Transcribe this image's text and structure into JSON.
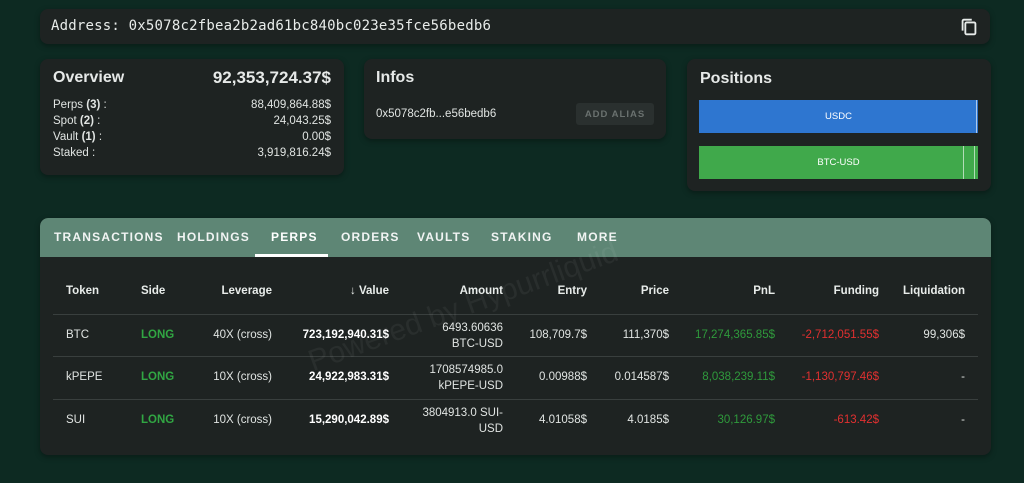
{
  "address_bar": {
    "label": "Address:",
    "address": "0x5078c2fbea2b2ad61bc840bc023e35fce56bedb6",
    "copy_icon": "copy-icon"
  },
  "overview": {
    "title": "Overview",
    "total": "92,353,724.37$",
    "rows": [
      {
        "label": "Perps",
        "count": "(3)",
        "suffix": " :",
        "value": "88,409,864.88$"
      },
      {
        "label": "Spot",
        "count": "(2)",
        "suffix": " :",
        "value": "24,043.25$"
      },
      {
        "label": "Vault",
        "count": "(1)",
        "suffix": " :",
        "value": "0.00$"
      },
      {
        "label": "Staked",
        "count": "",
        "suffix": " :",
        "value": "3,919,816.24$"
      }
    ]
  },
  "infos": {
    "title": "Infos",
    "short_address": "0x5078c2fb...e56bedb6",
    "alias_button": "ADD ALIAS"
  },
  "positions": {
    "title": "Positions",
    "bars": [
      {
        "label": "USDC",
        "color": "#2e76d0"
      },
      {
        "label": "BTC-USD",
        "color": "#40a94b"
      }
    ]
  },
  "tabs": [
    "TRANSACTIONS",
    "HOLDINGS",
    "PERPS",
    "ORDERS",
    "VAULTS",
    "STAKING",
    "MORE"
  ],
  "active_tab": "PERPS",
  "table": {
    "headers": [
      "Token",
      "Side",
      "Leverage",
      "Value",
      "Amount",
      "Entry",
      "Price",
      "PnL",
      "Funding",
      "Liquidation"
    ],
    "sort_icon": "arrow-down-icon",
    "rows": [
      {
        "token": "BTC",
        "side": "LONG",
        "leverage": "40X (cross)",
        "value": "723,192,940.31$",
        "amount_1": "6493.60636",
        "amount_2": "BTC-USD",
        "entry": "108,709.7$",
        "price": "111,370$",
        "pnl": "17,274,365.85$",
        "funding": "-2,712,051.55$",
        "liquidation": "99,306$"
      },
      {
        "token": "kPEPE",
        "side": "LONG",
        "leverage": "10X (cross)",
        "value": "24,922,983.31$",
        "amount_1": "1708574985.0",
        "amount_2": "kPEPE-USD",
        "entry": "0.00988$",
        "price": "0.014587$",
        "pnl": "8,038,239.11$",
        "funding": "-1,130,797.46$",
        "liquidation": "-"
      },
      {
        "token": "SUI",
        "side": "LONG",
        "leverage": "10X (cross)",
        "value": "15,290,042.89$",
        "amount_1": "3804913.0 SUI-",
        "amount_2": "USD",
        "entry": "4.01058$",
        "price": "4.0185$",
        "pnl": "30,126.97$",
        "funding": "-613.42$",
        "liquidation": "-"
      }
    ]
  },
  "watermark": "Powered by Hypurrliquid",
  "colors": {
    "background": "#0d2a22",
    "card": "#1e2322",
    "tabbar": "#5e8675",
    "long": "#31a643",
    "negative": "#e23030"
  }
}
